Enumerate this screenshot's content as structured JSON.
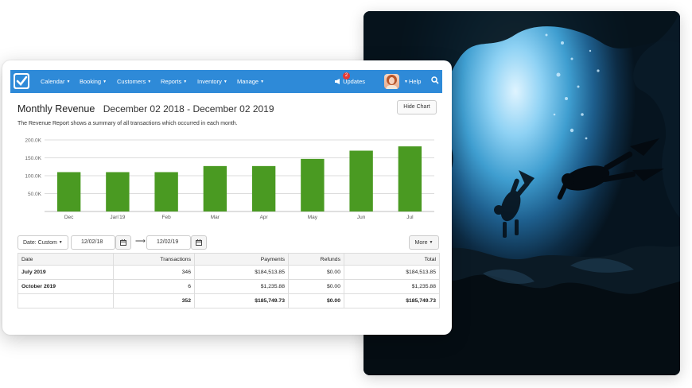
{
  "nav": {
    "items": [
      "Calendar",
      "Booking",
      "Customers",
      "Reports",
      "Inventory",
      "Manage"
    ],
    "updates_label": "Updates",
    "updates_count": "2",
    "help_label": "Help"
  },
  "header": {
    "title": "Monthly Revenue",
    "date_range": "December 02 2018 - December 02 2019",
    "hide_chart_label": "Hide Chart",
    "description": "The Revenue Report shows a summary of all transactions which occurred in each month."
  },
  "chart_data": {
    "type": "bar",
    "categories": [
      "Dec",
      "Jan'19",
      "Feb",
      "Mar",
      "Apr",
      "May",
      "Jun",
      "Jul"
    ],
    "values": [
      110000,
      110000,
      110000,
      127000,
      127000,
      147000,
      170000,
      182000
    ],
    "ylim": [
      0,
      200000
    ],
    "yticks": [
      50000,
      100000,
      150000,
      200000
    ],
    "ytick_labels": [
      "50.0K",
      "100.0K",
      "150.0K",
      "200.0K"
    ],
    "bar_color": "#4a9a22",
    "grid": true
  },
  "filters": {
    "date_type": "Date: Custom",
    "start_date": "12/02/18",
    "end_date": "12/02/19",
    "more_label": "More"
  },
  "table": {
    "columns": [
      "Date",
      "Transactions",
      "Payments",
      "Refunds",
      "Total"
    ],
    "rows": [
      [
        "July 2019",
        "346",
        "$184,513.85",
        "$0.00",
        "$184,513.85"
      ],
      [
        "October 2019",
        "6",
        "$1,235.88",
        "$0.00",
        "$1,235.88"
      ]
    ],
    "totals": [
      "",
      "352",
      "$185,749.73",
      "$0.00",
      "$185,749.73"
    ]
  },
  "colors": {
    "nav": "#2e8ad8",
    "bars": "#4a9a22"
  }
}
